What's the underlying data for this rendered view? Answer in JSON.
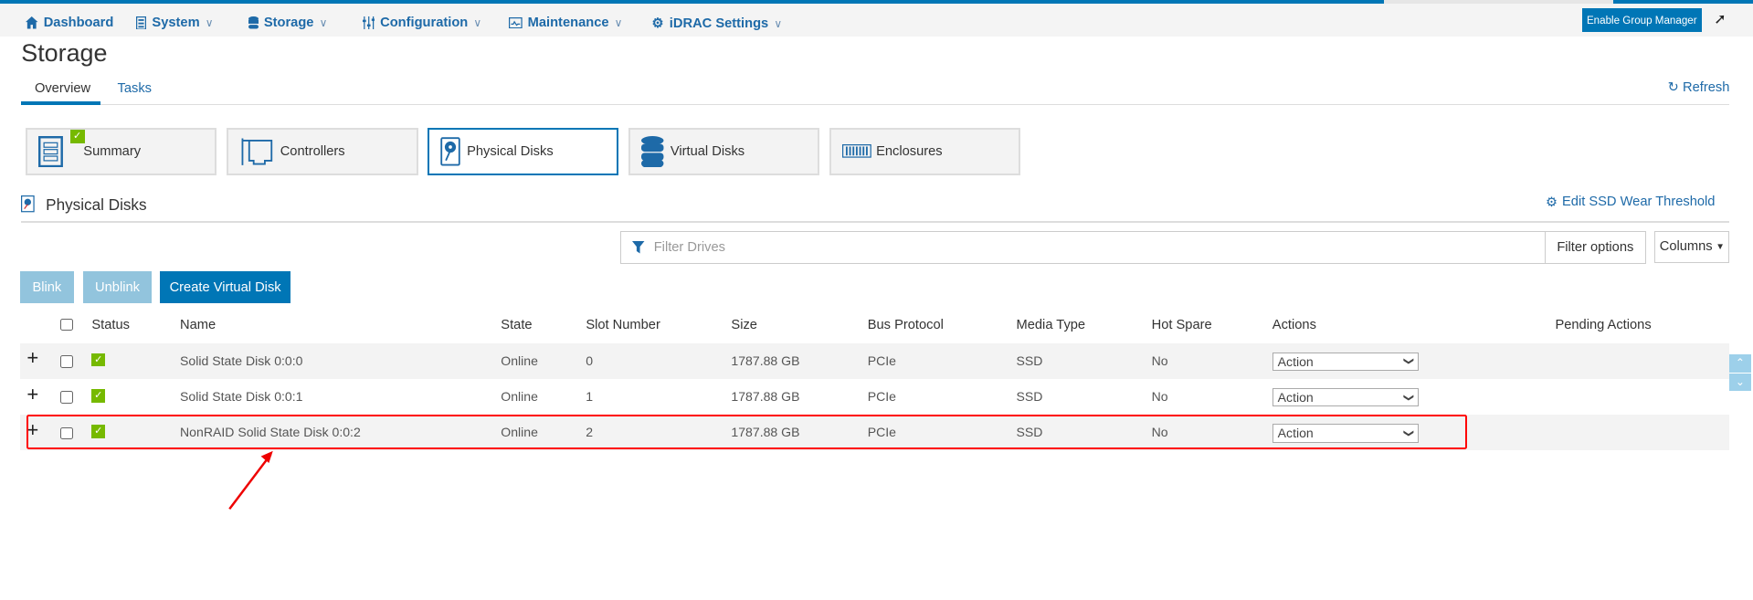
{
  "nav": {
    "items": [
      {
        "label": "Dashboard",
        "icon": "home-icon"
      },
      {
        "label": "System",
        "icon": "server-icon"
      },
      {
        "label": "Storage",
        "icon": "database-icon"
      },
      {
        "label": "Configuration",
        "icon": "sliders-icon"
      },
      {
        "label": "Maintenance",
        "icon": "monitor-icon"
      },
      {
        "label": "iDRAC Settings",
        "icon": "gears-icon"
      }
    ],
    "group_manager_button": "Enable Group Manager"
  },
  "page": {
    "title": "Storage",
    "tabs": [
      "Overview",
      "Tasks"
    ],
    "refresh": "Refresh"
  },
  "tiles": [
    "Summary",
    "Controllers",
    "Physical Disks",
    "Virtual Disks",
    "Enclosures"
  ],
  "section": {
    "title": "Physical Disks",
    "edit_link": "Edit SSD Wear Threshold",
    "filter_placeholder": "Filter Drives",
    "filter_options": "Filter options",
    "columns": "Columns",
    "buttons": {
      "blink": "Blink",
      "unblink": "Unblink",
      "create": "Create Virtual Disk"
    }
  },
  "table": {
    "headers": [
      "Status",
      "Name",
      "State",
      "Slot Number",
      "Size",
      "Bus Protocol",
      "Media Type",
      "Hot Spare",
      "Actions",
      "Pending Actions"
    ],
    "rows": [
      {
        "name": "Solid State Disk 0:0:0",
        "state": "Online",
        "slot": "0",
        "size": "1787.88 GB",
        "bus": "PCIe",
        "media": "SSD",
        "hot_spare": "No",
        "action": "Action"
      },
      {
        "name": "Solid State Disk 0:0:1",
        "state": "Online",
        "slot": "1",
        "size": "1787.88 GB",
        "bus": "PCIe",
        "media": "SSD",
        "hot_spare": "No",
        "action": "Action"
      },
      {
        "name": "NonRAID Solid State Disk 0:0:2",
        "state": "Online",
        "slot": "2",
        "size": "1787.88 GB",
        "bus": "PCIe",
        "media": "SSD",
        "hot_spare": "No",
        "action": "Action"
      }
    ]
  },
  "colors": {
    "accent": "#0076b6",
    "ok": "#76b900",
    "highlight": "#ff0000"
  }
}
